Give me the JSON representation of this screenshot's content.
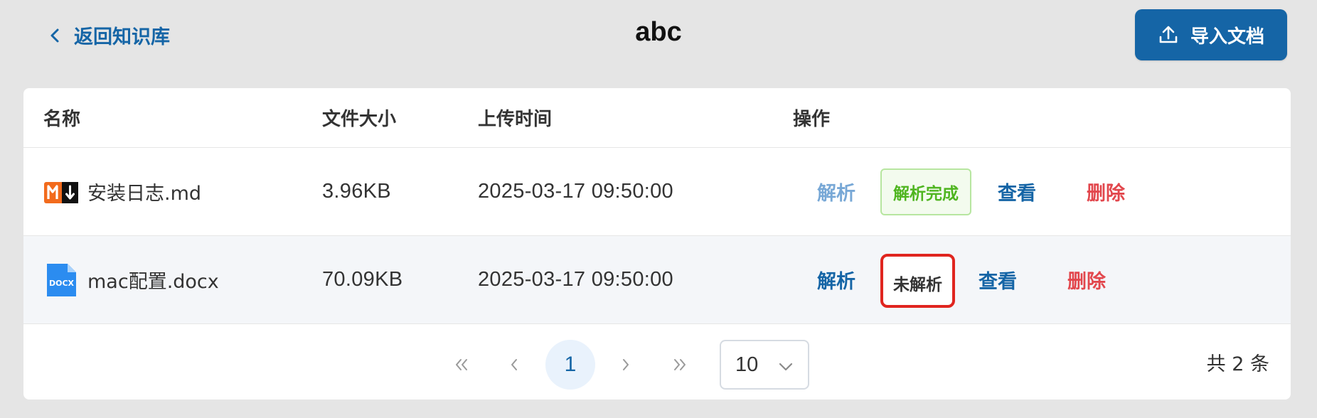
{
  "header": {
    "back_label": "返回知识库",
    "title": "abc",
    "import_label": "导入文档"
  },
  "table": {
    "columns": [
      "名称",
      "文件大小",
      "上传时间",
      "操作"
    ],
    "rows": [
      {
        "name": "安装日志.md",
        "file_icon": "markdown-file-icon",
        "size": "3.96KB",
        "time": "2025-03-17 09:50:00",
        "parse_label": "解析",
        "status": "解析完成",
        "view_label": "查看",
        "delete_label": "删除"
      },
      {
        "name": "mac配置.docx",
        "file_icon": "docx-file-icon",
        "size": "70.09KB",
        "time": "2025-03-17 09:50:00",
        "parse_label": "解析",
        "status": "未解析",
        "view_label": "查看",
        "delete_label": "删除"
      }
    ]
  },
  "pagination": {
    "current_page": "1",
    "page_size": "10",
    "total_text": "共 2 条"
  },
  "colors": {
    "primary": "#1565a6",
    "danger": "#e2474d",
    "success": "#4fb520",
    "highlight": "#e0251f"
  }
}
